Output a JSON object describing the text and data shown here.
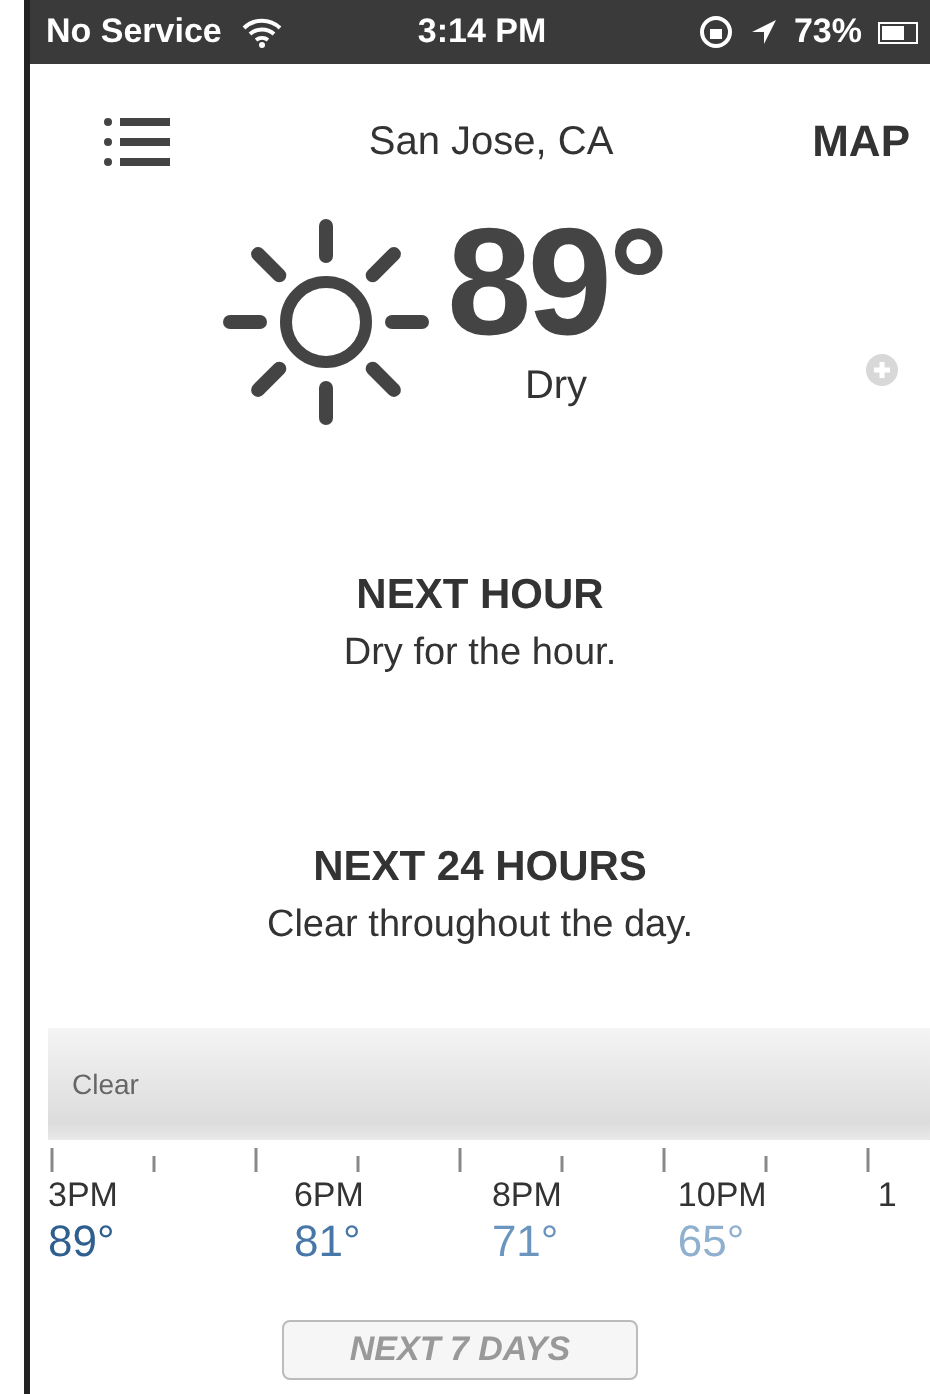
{
  "status_bar": {
    "carrier": "No Service",
    "time": "3:14 PM",
    "battery": "73%"
  },
  "header": {
    "location": "San Jose, CA",
    "map_button": "MAP"
  },
  "current": {
    "temperature": "89°",
    "summary": "Dry"
  },
  "sections": [
    {
      "title": "NEXT HOUR",
      "text": "Dry for the hour."
    },
    {
      "title": "NEXT 24 HOURS",
      "text": "Clear throughout the day."
    }
  ],
  "timeline": {
    "band_label": "Clear",
    "hours": [
      {
        "time": "3PM",
        "temp": "89°",
        "color": "#2f5f8f"
      },
      {
        "time": "6PM",
        "temp": "81°",
        "color": "#4677a8"
      },
      {
        "time": "8PM",
        "temp": "71°",
        "color": "#6a95bf"
      },
      {
        "time": "10PM",
        "temp": "65°",
        "color": "#8fb0cf"
      },
      {
        "time": "1"
      }
    ]
  },
  "footer_button": "NEXT 7 DAYS"
}
